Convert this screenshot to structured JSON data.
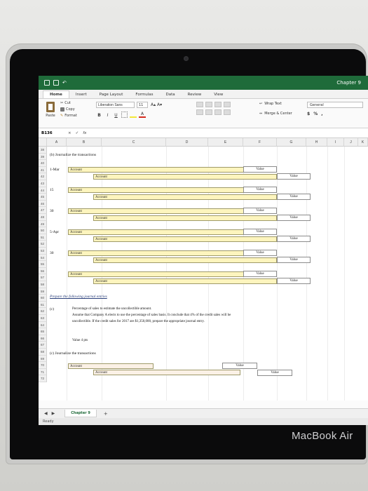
{
  "device": {
    "brand": "MacBook Air"
  },
  "window": {
    "title": "Chapter 9"
  },
  "ribbon": {
    "tabs": [
      "Home",
      "Insert",
      "Page Layout",
      "Formulas",
      "Data",
      "Review",
      "View"
    ],
    "active_tab": "Home",
    "clipboard": {
      "paste": "Paste",
      "cut": "Cut",
      "copy": "Copy",
      "format": "Format"
    },
    "font": {
      "family": "Liberation Sans",
      "size": "11",
      "grow": "A▴",
      "shrink": "A▾"
    },
    "styles": {
      "bold": "B",
      "italic": "I",
      "underline": "U"
    },
    "alignment": {
      "wrap_text": "Wrap Text",
      "merge_center": "Merge & Center"
    },
    "number": {
      "format": "General",
      "currency": "$",
      "percent": "%",
      "comma": ","
    },
    "colors": {
      "accent": "#1f6b3a",
      "fill": "#f3e73a",
      "font_color": "#d52b1e"
    }
  },
  "formula_bar": {
    "name_box": "B136",
    "fx": "fx",
    "cancel": "×",
    "enter": "✓"
  },
  "columns": [
    "A",
    "B",
    "C",
    "D",
    "E",
    "F",
    "G",
    "H",
    "I",
    "J",
    "K"
  ],
  "rows": [
    "38",
    "39",
    "40",
    "41",
    "42",
    "43",
    "44",
    "45",
    "46",
    "47",
    "48",
    "49",
    "50",
    "51",
    "52",
    "53",
    "54",
    "55",
    "56",
    "57",
    "58",
    "59",
    "60",
    "61",
    "62",
    "63",
    "64",
    "65",
    "66",
    "67",
    "68",
    "69",
    "70",
    "71",
    "72"
  ],
  "sheet": {
    "section_b_heading": "(b)  Journalize the transactions",
    "entries": [
      {
        "date": "1-Mar",
        "debit": "Account",
        "credit": "Account",
        "debit_value": "Value",
        "credit_value": "Value"
      },
      {
        "date": "15",
        "debit": "Account",
        "credit": "Account",
        "debit_value": "Value",
        "credit_value": "Value"
      },
      {
        "date": "30",
        "debit": "Account",
        "credit": "Account",
        "debit_value": "Value",
        "credit_value": "Value"
      },
      {
        "date": "5-Apr",
        "debit": "Account",
        "credit": "Account",
        "debit_value": "Value",
        "credit_value": "Value"
      },
      {
        "date": "30",
        "debit": "Account",
        "credit": "Account",
        "debit_value": "Value",
        "credit_value": "Value"
      },
      {
        "date": "",
        "debit": "Account",
        "credit": "Account",
        "debit_value": "Value",
        "credit_value": "Value"
      }
    ],
    "prepare_link": "Prepare the following journal entries",
    "part_c_label": "(c)",
    "part_c_line1": "Percentage of sales to estimate the uncollectible amount.",
    "part_c_line2": "Assume that Company A elects to use the percentage of sales basis. It conclude that 4% of the credit sales will be",
    "part_c_line3": "uncollectible. If the credit sales for 2017 are $1,350,000, prepare the appropriate journal entry.",
    "value_note": "Value 4 pts",
    "section_c_heading": "(c)  Journalize the transactions",
    "final_entry": {
      "debit": "Account",
      "credit": "Account",
      "debit_value": "Value",
      "credit_value": "Value"
    }
  },
  "sheet_tabs": {
    "active": "Chapter 9",
    "add": "+"
  },
  "status": {
    "text": "Ready"
  }
}
